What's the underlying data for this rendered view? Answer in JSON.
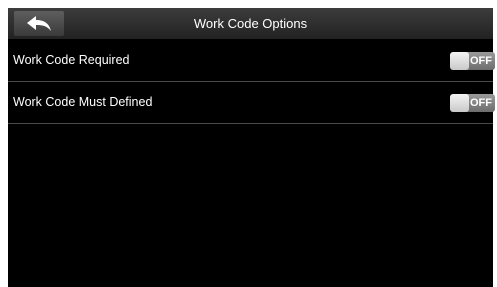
{
  "header": {
    "title": "Work Code Options",
    "back_icon": "back-arrow-icon"
  },
  "settings": [
    {
      "label": "Work Code Required",
      "state": "OFF",
      "enabled": false
    },
    {
      "label": "Work Code Must Defined",
      "state": "OFF",
      "enabled": false
    }
  ],
  "colors": {
    "background": "#000000",
    "header": "#2e2e2e",
    "text": "#ffffff",
    "toggle_off": "#7f7f7f",
    "divider": "#4a4a4a"
  }
}
